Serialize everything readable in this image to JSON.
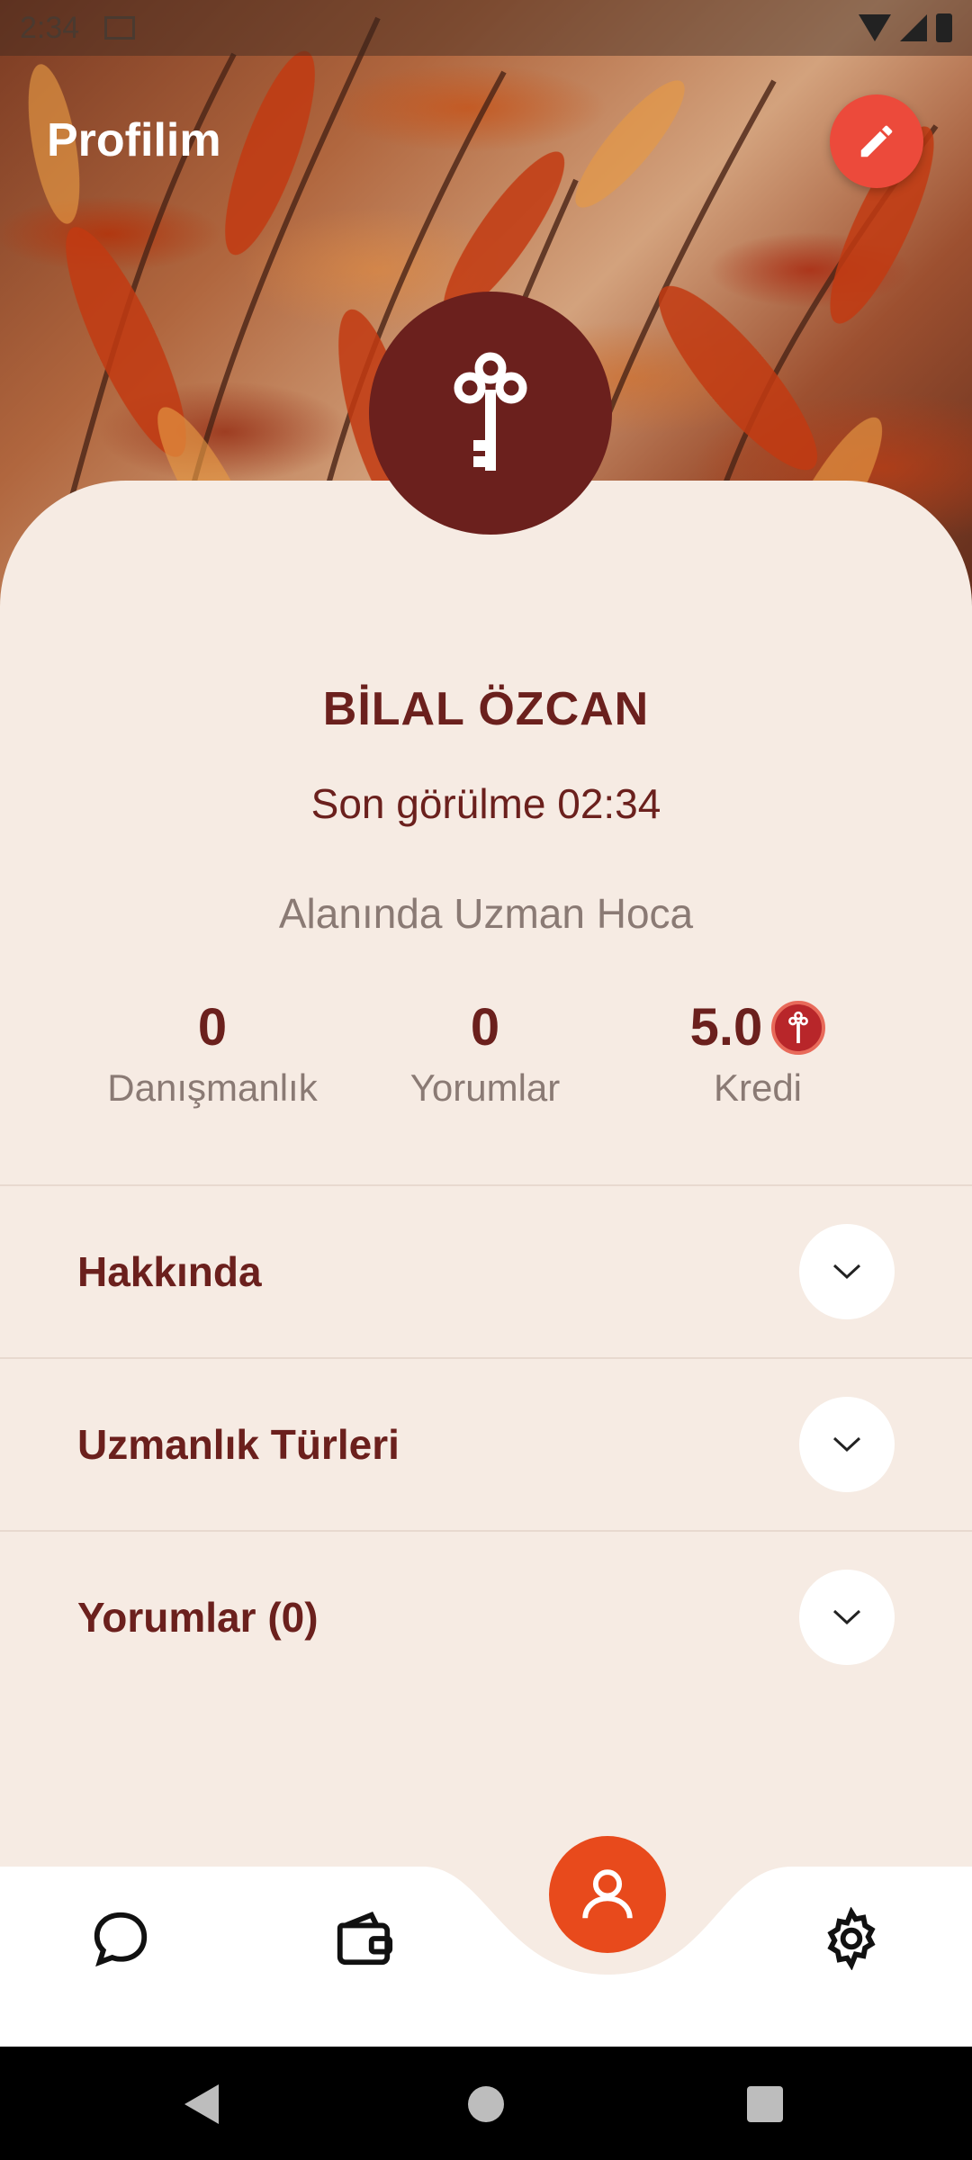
{
  "status_bar": {
    "time": "2:34"
  },
  "header": {
    "title": "Profilim",
    "edit_icon": "pencil-icon"
  },
  "profile": {
    "avatar_icon": "key-icon",
    "name": "BİLAL ÖZCAN",
    "last_seen": "Son görülme 02:34",
    "title": "Alanında Uzman Hoca"
  },
  "stats": [
    {
      "value": "0",
      "label": "Danışmanlık"
    },
    {
      "value": "0",
      "label": "Yorumlar"
    },
    {
      "value": "5.0",
      "label": "Kredi"
    }
  ],
  "sections": [
    {
      "label": "Hakkında"
    },
    {
      "label": "Uzmanlık Türleri"
    },
    {
      "label": "Yorumlar (0)"
    }
  ],
  "bottom_nav": {
    "items": [
      "chat-icon",
      "wallet-icon",
      "profile-icon",
      "settings-icon"
    ],
    "active": "profile-icon"
  },
  "colors": {
    "brand_dark": "#6b201d",
    "accent": "#e84a1c",
    "edit_button": "#ec4a3b",
    "card_bg": "#f6ebe3"
  }
}
